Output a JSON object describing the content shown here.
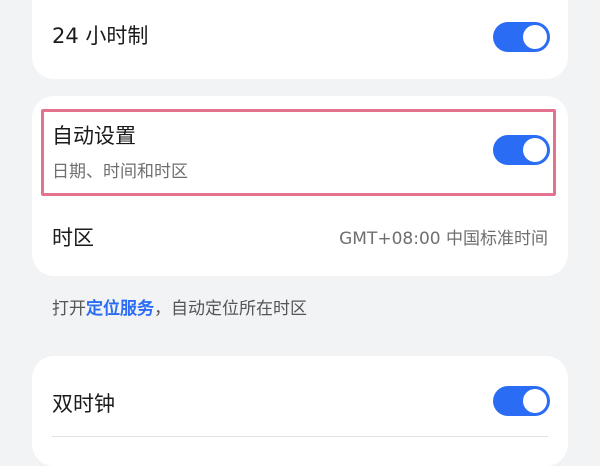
{
  "clock24": {
    "label": "24 小时制",
    "enabled": true
  },
  "auto_set": {
    "label": "自动设置",
    "sublabel": "日期、时间和时区",
    "enabled": true
  },
  "timezone": {
    "label": "时区",
    "value": "GMT+08:00 中国标准时间"
  },
  "hint": {
    "prefix": "打开",
    "link": "定位服务",
    "suffix": "，自动定位所在时区"
  },
  "dual_clock": {
    "label": "双时钟",
    "enabled": true
  },
  "colors": {
    "accent": "#2a6df4",
    "highlight": "#e5738f",
    "background": "#f1f3f5"
  }
}
